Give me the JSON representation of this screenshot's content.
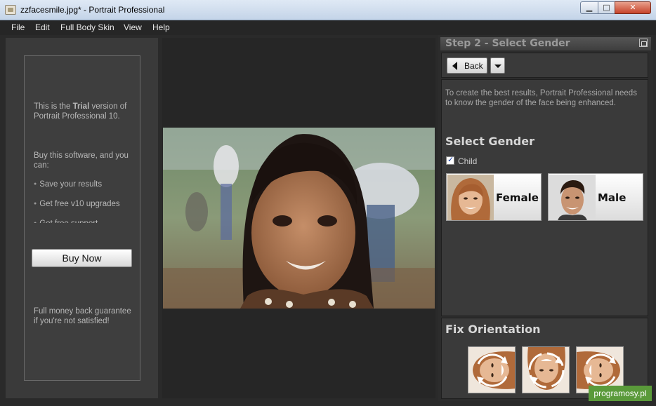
{
  "window": {
    "title": "zzfacesmile.jpg* - Portrait Professional",
    "controls": {
      "minimize": "▁",
      "maximize": "□",
      "close": "✕"
    }
  },
  "menu": [
    "File",
    "Edit",
    "Full Body Skin",
    "View",
    "Help"
  ],
  "trial": {
    "line1_pre": "This is the ",
    "line1_bold": "Trial",
    "line1_post": " version of",
    "line2": "Portrait Professional 10.",
    "buy_intro": "Buy this software, and you can:",
    "bullets": [
      "Save your results",
      "Get free v10 upgrades",
      "Get free support"
    ],
    "buy_button": "Buy Now",
    "guarantee": "Full money back guarantee if you're not satisfied!"
  },
  "panel": {
    "title": "Step 2 - Select Gender",
    "back_label": "Back",
    "intro": "To create the best results, Portrait Professional needs to know the gender of the face being enhanced.",
    "select_gender_title": "Select Gender",
    "child_label": "Child",
    "child_checked": true,
    "female_label": "Female",
    "male_label": "Male",
    "orientation_title": "Fix Orientation"
  },
  "icons": {
    "app": "app-document-icon",
    "restore": "restore-window-icon",
    "back": "back-arrow-icon",
    "dropdown": "chevron-down-icon",
    "rotate": "rotate-icon"
  },
  "watermark": "programosy.pl"
}
